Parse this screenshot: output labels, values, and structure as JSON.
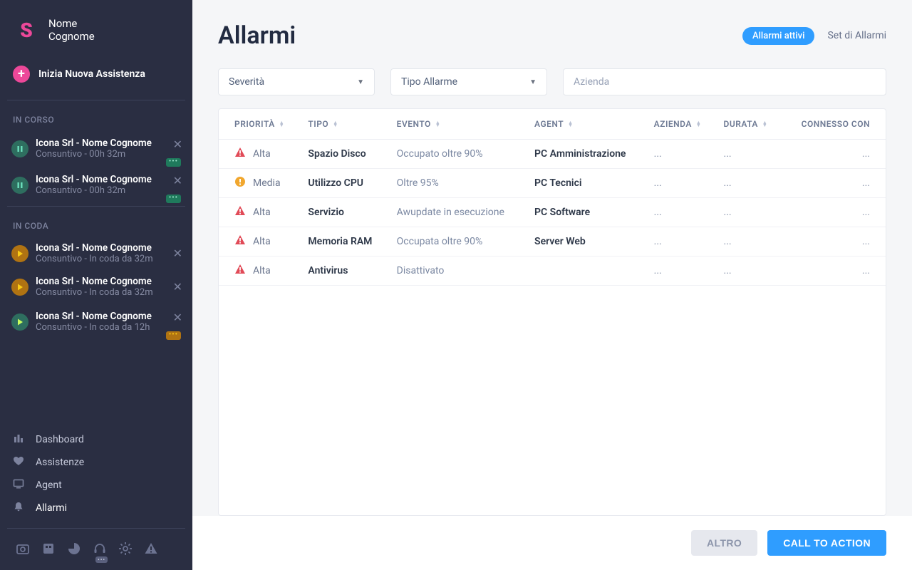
{
  "user": {
    "line1": "Nome",
    "line2": "Cognome"
  },
  "sidebar": {
    "new_assist": "Inizia Nuova Assistenza",
    "section_in_corso": "IN CORSO",
    "section_in_coda": "IN CODA",
    "in_corso": [
      {
        "title": "Icona Srl - Nome Cognome",
        "sub": "Consuntivo - 00h 32m"
      },
      {
        "title": "Icona Srl - Nome Cognome",
        "sub": "Consuntivo - 00h 32m"
      }
    ],
    "in_coda": [
      {
        "title": "Icona Srl - Nome Cognome",
        "sub": "Consuntivo - In coda da 32m"
      },
      {
        "title": "Icona Srl - Nome Cognome",
        "sub": "Consuntivo - In coda da 32m"
      },
      {
        "title": "Icona Srl - Nome Cognome",
        "sub": "Consuntivo - In coda da 12h"
      }
    ],
    "nav": [
      {
        "label": "Dashboard"
      },
      {
        "label": "Assistenze"
      },
      {
        "label": "Agent"
      },
      {
        "label": "Allarmi"
      }
    ]
  },
  "page": {
    "title": "Allarmi",
    "tab_active": "Allarmi attivi",
    "tab_other": "Set di Allarmi"
  },
  "filters": {
    "severity": "Severità",
    "type": "Tipo Allarme",
    "company_placeholder": "Azienda"
  },
  "columns": {
    "priorita": "PRIORITÀ",
    "tipo": "TIPO",
    "evento": "EVENTO",
    "agent": "AGENT",
    "azienda": "AZIENDA",
    "durata": "DURATA",
    "connesso": "CONNESSO CON"
  },
  "rows": [
    {
      "sev": "high",
      "priorita": "Alta",
      "tipo": "Spazio Disco",
      "evento": "Occupato oltre 90%",
      "agent": "PC Amministrazione",
      "azienda": "...",
      "durata": "...",
      "connesso": "..."
    },
    {
      "sev": "med",
      "priorita": "Media",
      "tipo": "Utilizzo CPU",
      "evento": "Oltre 95%",
      "agent": "PC Tecnici",
      "azienda": "...",
      "durata": "...",
      "connesso": "..."
    },
    {
      "sev": "high",
      "priorita": "Alta",
      "tipo": "Servizio",
      "evento": "Awupdate in esecuzione",
      "agent": "PC Software",
      "azienda": "...",
      "durata": "...",
      "connesso": "..."
    },
    {
      "sev": "high",
      "priorita": "Alta",
      "tipo": "Memoria RAM",
      "evento": "Occupata oltre 90%",
      "agent": "Server Web",
      "azienda": "...",
      "durata": "...",
      "connesso": "..."
    },
    {
      "sev": "high",
      "priorita": "Alta",
      "tipo": "Antivirus",
      "evento": "Disattivato",
      "agent": "",
      "azienda": "...",
      "durata": "...",
      "connesso": "..."
    }
  ],
  "footer": {
    "altro": "ALTRO",
    "cta": "CALL TO ACTION"
  }
}
